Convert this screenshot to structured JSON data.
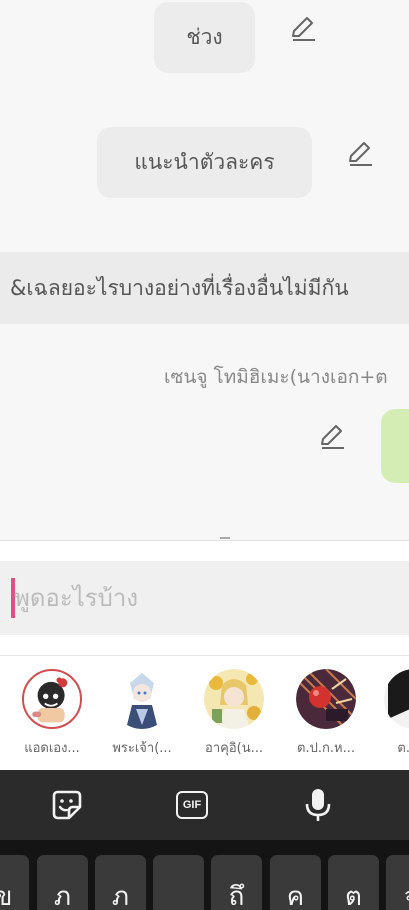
{
  "chat": {
    "bubbles": [
      {
        "label": "ช่วง"
      },
      {
        "label": "แนะนำตัวละคร"
      }
    ],
    "narration": "&เฉลยอะไรบางอย่างที่เรื่องอื่นไม่มีกัน",
    "character_name": "เซนจู โทมิฮิเมะ(นางเอก+ต"
  },
  "composer": {
    "placeholder": "พูดอะไรบ้าง",
    "value": ""
  },
  "characters": [
    {
      "label": "แอดเอง...",
      "selected": true
    },
    {
      "label": "พระเจ้า(...",
      "selected": false
    },
    {
      "label": "อาคุอิ(น...",
      "selected": false
    },
    {
      "label": "ต.ป.ก.ห...",
      "selected": false
    },
    {
      "label": "ต.ป...",
      "selected": false
    }
  ],
  "keyboard_toolbar": {
    "sticker_icon": "sticker-icon",
    "gif_label": "GIF",
    "mic_icon": "microphone-icon"
  },
  "keyboard": {
    "keys": [
      "ข",
      "ภ",
      "ภ",
      "",
      "ถึ",
      "ค",
      "ต",
      "จ"
    ]
  },
  "colors": {
    "caret": "#e14f84",
    "selected_avatar_ring": "#d24d4d",
    "green_bubble": "#d4edb4"
  }
}
